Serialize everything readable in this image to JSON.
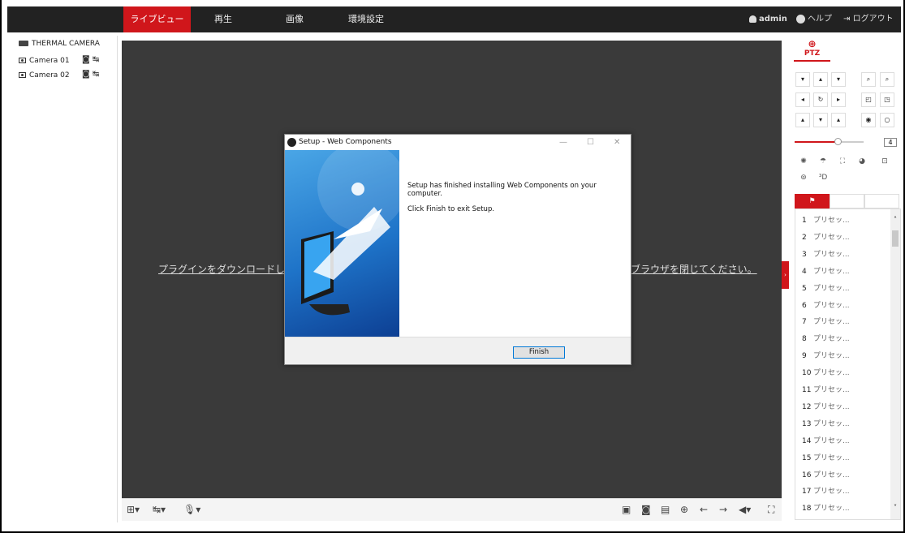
{
  "nav": {
    "tabs": [
      {
        "label": "ライブビュー",
        "active": true
      },
      {
        "label": "再生",
        "active": false
      },
      {
        "label": "画像",
        "active": false
      },
      {
        "label": "環境設定",
        "active": false
      }
    ],
    "user": "admin",
    "help": "ヘルプ",
    "logout": "ログアウト"
  },
  "tree": {
    "device": "THERMAL CAMERA",
    "cameras": [
      "Camera 01",
      "Camera 02"
    ]
  },
  "video": {
    "message_left": "プラグインをダウンロードしイ",
    "message_right": "ブラウザを閉じてください。"
  },
  "dialog": {
    "title": "Setup - Web Components",
    "line1": "Setup has finished installing Web Components on your computer.",
    "line2": "Click Finish to exit Setup.",
    "finish": "Finish"
  },
  "ptz": {
    "label": "PTZ",
    "speed": "4",
    "speed_level": 0.62
  },
  "presets": [
    {
      "num": "1",
      "label": "プリセッ..."
    },
    {
      "num": "2",
      "label": "プリセッ..."
    },
    {
      "num": "3",
      "label": "プリセッ..."
    },
    {
      "num": "4",
      "label": "プリセッ..."
    },
    {
      "num": "5",
      "label": "プリセッ..."
    },
    {
      "num": "6",
      "label": "プリセッ..."
    },
    {
      "num": "7",
      "label": "プリセッ..."
    },
    {
      "num": "8",
      "label": "プリセッ..."
    },
    {
      "num": "9",
      "label": "プリセッ..."
    },
    {
      "num": "10",
      "label": "プリセッ..."
    },
    {
      "num": "11",
      "label": "プリセッ..."
    },
    {
      "num": "12",
      "label": "プリセッ..."
    },
    {
      "num": "13",
      "label": "プリセッ..."
    },
    {
      "num": "14",
      "label": "プリセッ..."
    },
    {
      "num": "15",
      "label": "プリセッ..."
    },
    {
      "num": "16",
      "label": "プリセッ..."
    },
    {
      "num": "17",
      "label": "プリセッ..."
    },
    {
      "num": "18",
      "label": "プリセッ..."
    }
  ],
  "colors": {
    "accent": "#d0161b",
    "topbar": "#222222",
    "video_bg": "#3a3a3a"
  }
}
